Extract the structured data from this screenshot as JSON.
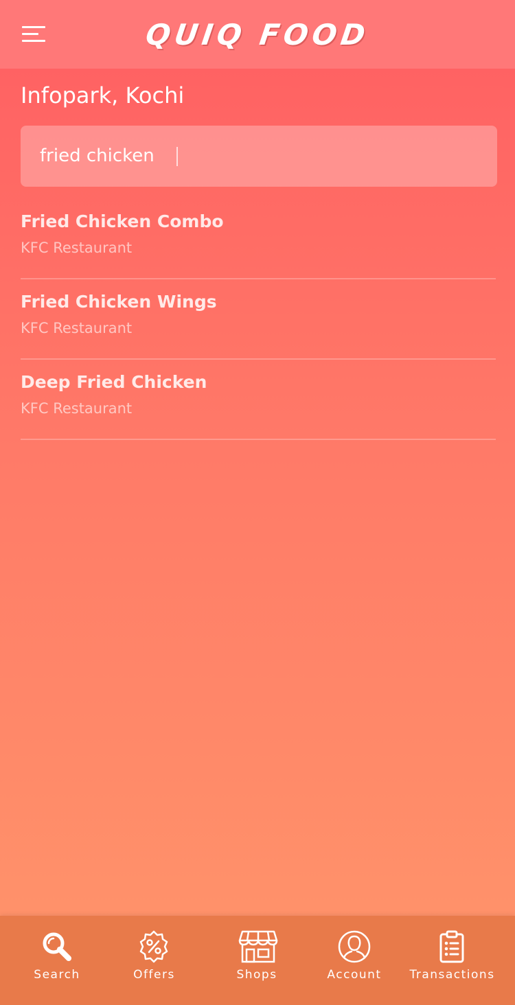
{
  "header": {
    "app_title": "QUIQ FOOD",
    "menu_icon": "hamburger-menu-icon"
  },
  "location": "Infopark, Kochi",
  "search": {
    "value": "fried chicken",
    "placeholder": ""
  },
  "results": [
    {
      "title": "Fried Chicken Combo",
      "restaurant": "KFC Restaurant"
    },
    {
      "title": "Fried Chicken Wings",
      "restaurant": "KFC Restaurant"
    },
    {
      "title": "Deep Fried Chicken",
      "restaurant": "KFC Restaurant"
    }
  ],
  "bottom_nav": [
    {
      "label": "Search",
      "icon": "search-icon"
    },
    {
      "label": "Offers",
      "icon": "percent-badge-icon"
    },
    {
      "label": "Shops",
      "icon": "storefront-icon"
    },
    {
      "label": "Account",
      "icon": "user-icon"
    },
    {
      "label": "Transactions",
      "icon": "clipboard-list-icon"
    }
  ],
  "colors": {
    "header": "#ff7878",
    "gradient_top": "#ff5e62",
    "gradient_bottom": "#ff966a",
    "bottom_nav": "#e87a4a"
  }
}
